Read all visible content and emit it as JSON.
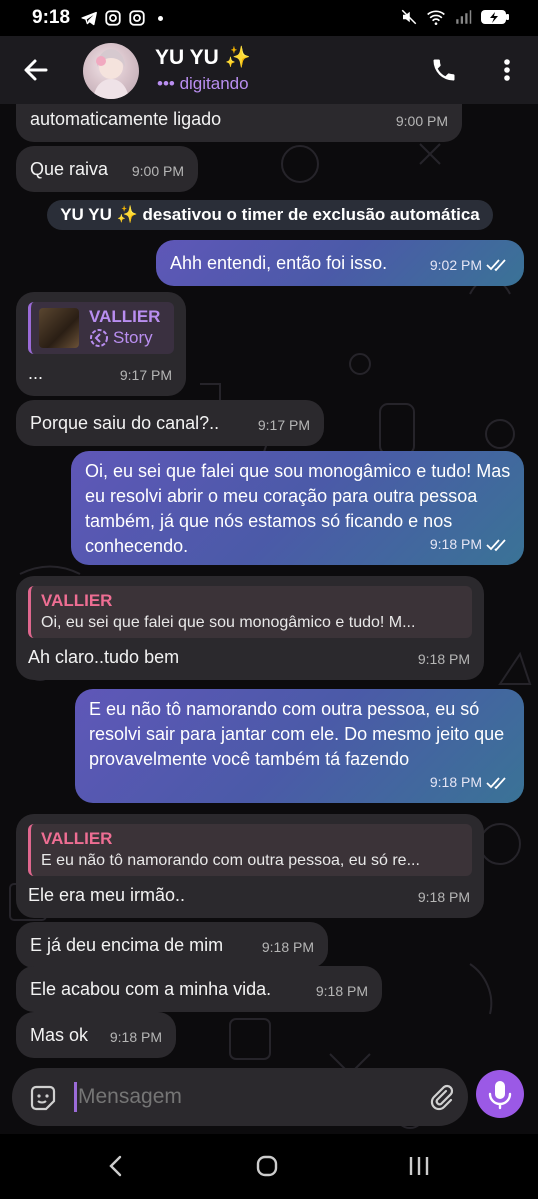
{
  "status_bar": {
    "time": "9:18"
  },
  "header": {
    "name": "YU YU ✨",
    "status": "••• digitando"
  },
  "messages": {
    "m1": {
      "text": "automaticamente ligado",
      "time": "9:00 PM"
    },
    "m2": {
      "text": "Que raiva",
      "time": "9:00 PM"
    },
    "service": "YU YU ✨ desativou o timer de exclusão automática",
    "m3": {
      "text": "Ahh entendi, então foi isso.",
      "time": "9:02 PM"
    },
    "m4": {
      "story_sender": "VALLIER",
      "story_label": "Story",
      "text": "...",
      "time": "9:17 PM"
    },
    "m5": {
      "text": "Porque saiu do canal?..",
      "time": "9:17 PM"
    },
    "m6": {
      "text": "Oi, eu sei que falei que sou monogâmico e tudo! Mas eu resolvi abrir o meu coração para outra pessoa também, já que nós estamos só ficando e nos conhecendo.",
      "time": "9:18 PM"
    },
    "m7": {
      "reply_name": "VALLIER",
      "reply_text": "Oi, eu sei que falei que sou monogâmico e tudo! M...",
      "text": "Ah claro..tudo bem",
      "time": "9:18 PM"
    },
    "m8": {
      "text": "E eu não tô namorando com outra pessoa, eu só resolvi sair para jantar com ele. Do mesmo jeito que provavelmente você também tá fazendo",
      "time": "9:18 PM"
    },
    "m9": {
      "reply_name": "VALLIER",
      "reply_text": "E eu não tô namorando com outra pessoa, eu só re...",
      "text": "Ele era meu irmão..",
      "time": "9:18 PM"
    },
    "m10": {
      "text": "E já deu encima de mim",
      "time": "9:18 PM"
    },
    "m11": {
      "text": "Ele acabou com a minha vida.",
      "time": "9:18 PM"
    },
    "m12": {
      "text": "Mas ok",
      "time": "9:18 PM"
    }
  },
  "composer": {
    "placeholder": "Mensagem"
  },
  "colors": {
    "accent": "#9b59e6",
    "reply_accent": "#ee6e93",
    "link": "#b98ef0"
  }
}
